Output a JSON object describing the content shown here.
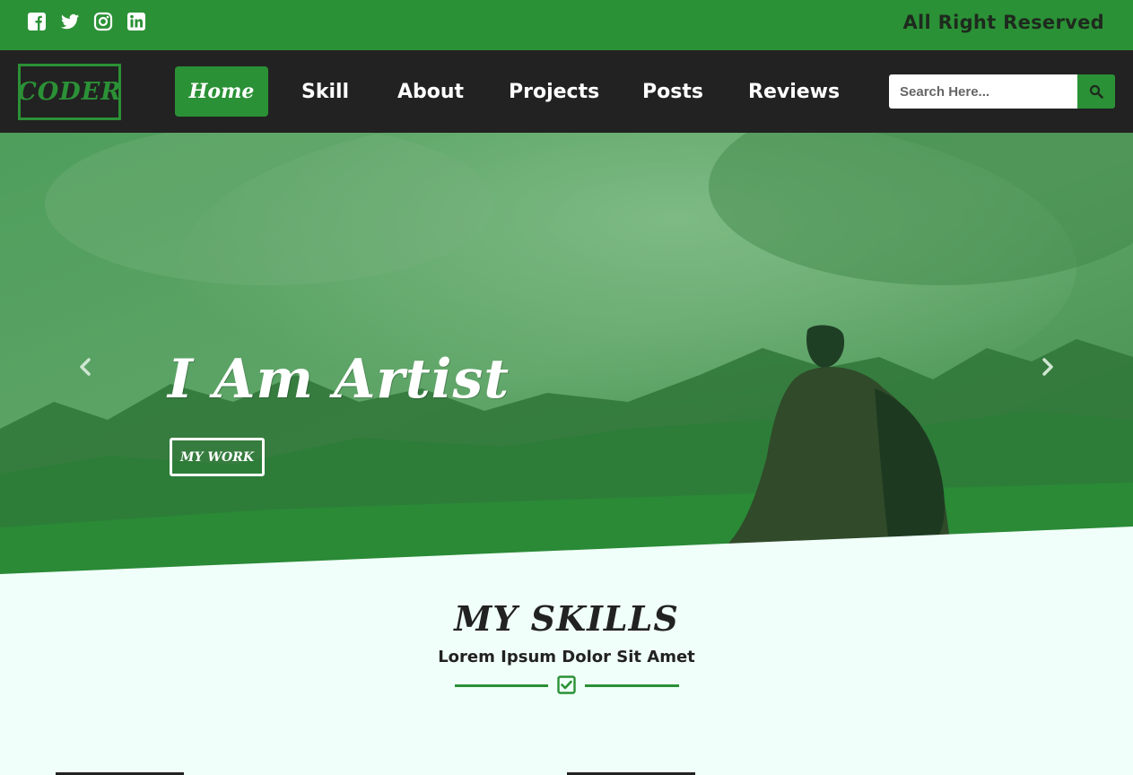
{
  "topbar": {
    "social_icons": [
      "facebook-icon",
      "twitter-icon",
      "instagram-icon",
      "linkedin-icon"
    ],
    "rights_text": "All Right Reserved"
  },
  "navbar": {
    "logo": "CODER",
    "items": [
      {
        "label": "Home",
        "active": true
      },
      {
        "label": "Skill"
      },
      {
        "label": "About"
      },
      {
        "label": "Projects"
      },
      {
        "label": "Posts"
      },
      {
        "label": "Reviews"
      }
    ],
    "search": {
      "placeholder": "Search Here...",
      "icon": "search-icon"
    }
  },
  "hero": {
    "title": "I Am Artist",
    "button_label": "MY WORK",
    "prev_icon": "chevron-left-icon",
    "next_icon": "chevron-right-icon"
  },
  "skills": {
    "title": "MY SKILLS",
    "subtitle": "Lorem Ipsum Dolor Sit Amet",
    "divider_icon": "check-square-icon"
  },
  "colors": {
    "accent": "#2b9136",
    "nav_bg": "#222222",
    "section_bg": "#f0fff9",
    "text_dark": "#222222"
  }
}
